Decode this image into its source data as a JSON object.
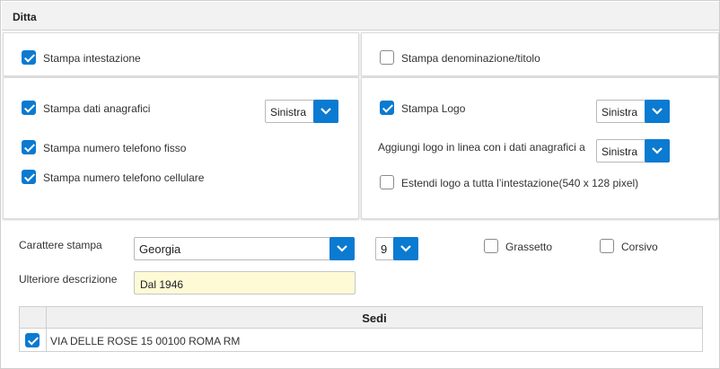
{
  "section": {
    "title": "Ditta"
  },
  "header_options": {
    "stampa_intestazione": {
      "label": "Stampa intestazione",
      "checked": true
    },
    "stampa_denominazione": {
      "label": "Stampa denominazione/titolo",
      "checked": false
    }
  },
  "anagrafica": {
    "stampa_dati_anagrafici": {
      "label": "Stampa dati anagrafici",
      "checked": true
    },
    "allineamento": "Sinistra",
    "stampa_telefono_fisso": {
      "label": "Stampa numero telefono fisso",
      "checked": true
    },
    "stampa_telefono_cellulare": {
      "label": "Stampa numero telefono cellulare",
      "checked": true
    }
  },
  "logo": {
    "stampa_logo": {
      "label": "Stampa Logo",
      "checked": true
    },
    "allineamento": "Sinistra",
    "logo_in_linea_label": "Aggiungi logo in linea con i dati anagrafici a",
    "logo_in_linea_value": "Sinistra",
    "estendi_logo": {
      "label": "Estendi logo a tutta l’intestazione(540 x 128 pixel)",
      "checked": false
    }
  },
  "font": {
    "carattere_label": "Carattere stampa",
    "carattere_value": "Georgia",
    "size_value": "9",
    "grassetto": {
      "label": "Grassetto",
      "checked": false
    },
    "corsivo": {
      "label": "Corsivo",
      "checked": false
    },
    "ulteriore_label": "Ulteriore descrizione",
    "ulteriore_value": "Dal 1946"
  },
  "sedi": {
    "header": "Sedi",
    "rows": [
      {
        "checked": true,
        "address": "VIA DELLE ROSE 15 00100 ROMA RM"
      }
    ]
  },
  "colors": {
    "accent": "#0b7ad1",
    "input_highlight": "#fefad6"
  }
}
